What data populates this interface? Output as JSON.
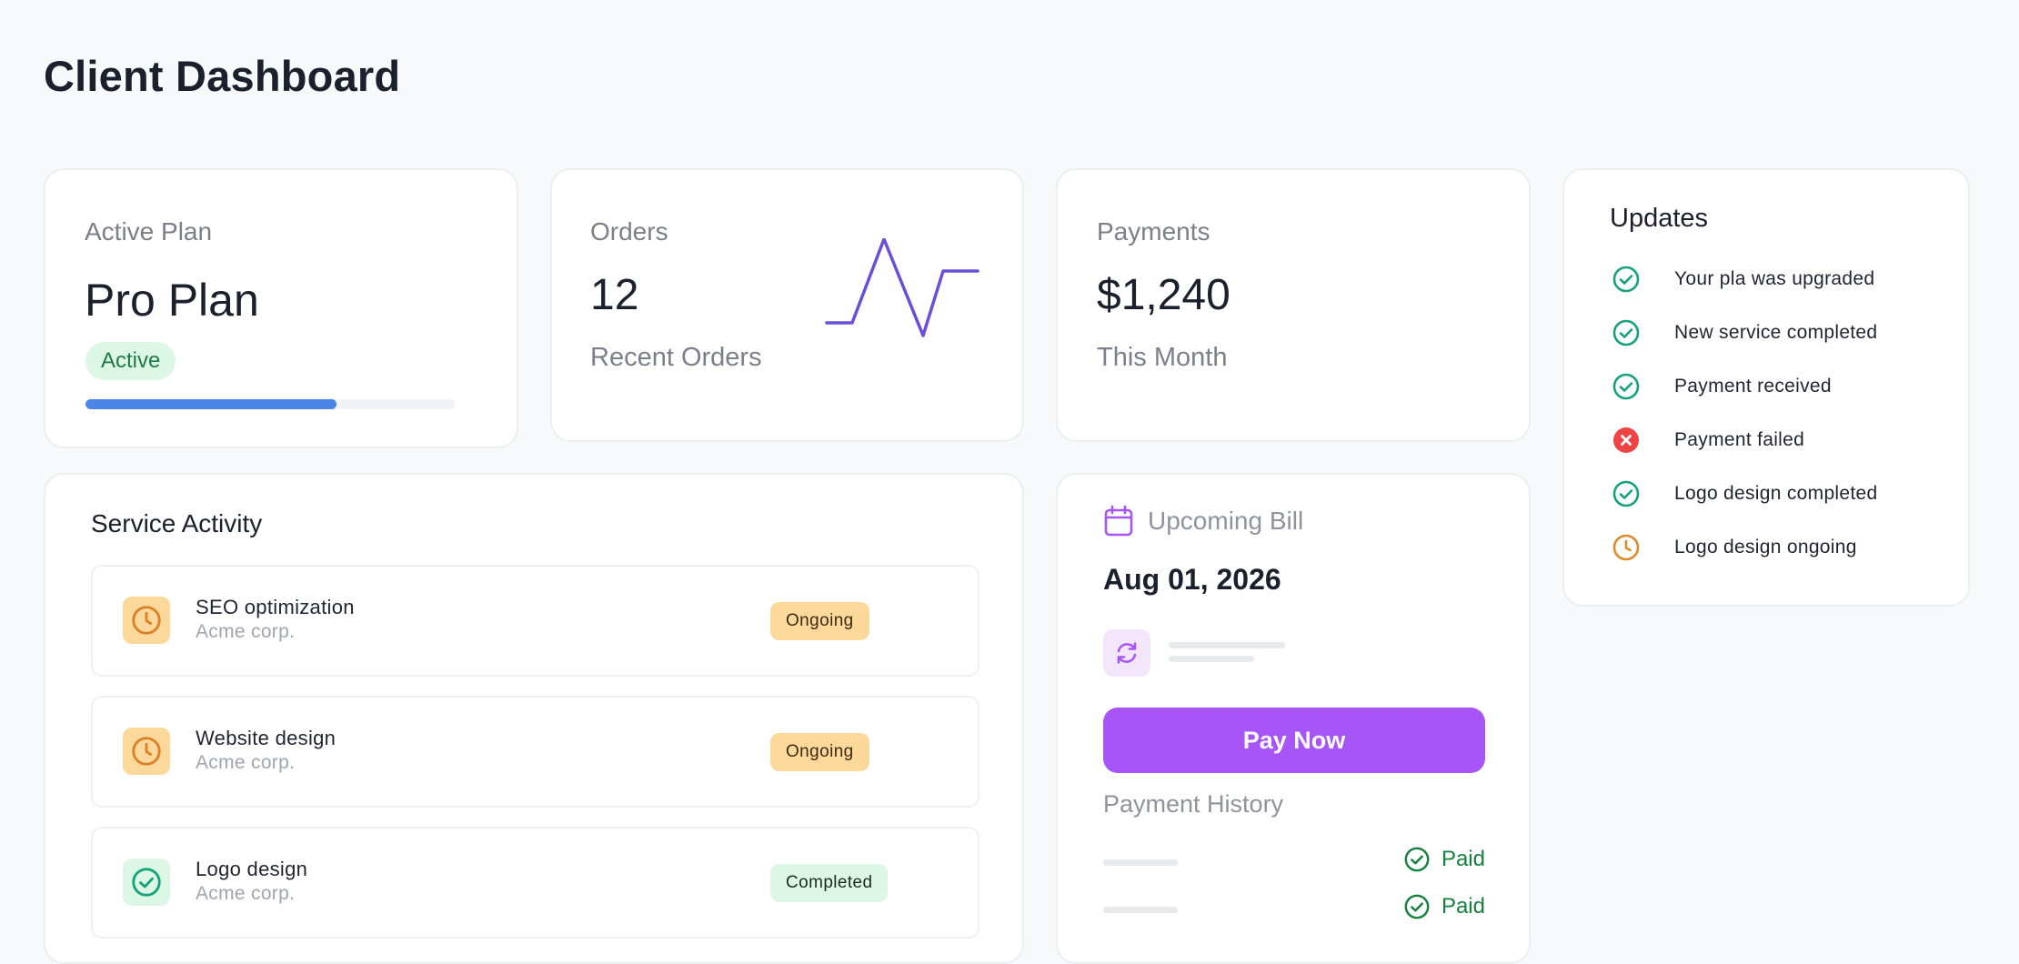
{
  "page": {
    "title": "Client Dashboard"
  },
  "plan": {
    "label": "Active Plan",
    "name": "Pro Plan",
    "status": "Active",
    "progress": 0.68
  },
  "orders": {
    "label": "Orders",
    "count": "12",
    "sub": "Recent Orders"
  },
  "payments": {
    "label": "Payments",
    "amount": "$1,240",
    "sub": "This Month"
  },
  "updates": {
    "title": "Updates",
    "items": [
      {
        "text": "Your pla was upgraded",
        "status": "success"
      },
      {
        "text": "New service completed",
        "status": "success"
      },
      {
        "text": "Payment received",
        "status": "success"
      },
      {
        "text": "Payment failed",
        "status": "error"
      },
      {
        "text": "Logo design completed",
        "status": "success"
      },
      {
        "text": "Logo design ongoing",
        "status": "pending"
      }
    ]
  },
  "service": {
    "title": "Service Activity",
    "rows": [
      {
        "name": "SEO optimization",
        "client": "Acme corp.",
        "status": "Ongoing"
      },
      {
        "name": "Website design",
        "client": "Acme corp.",
        "status": "Ongoing"
      },
      {
        "name": "Logo design",
        "client": "Acme corp.",
        "status": "Completed"
      }
    ]
  },
  "bill": {
    "label": "Upcoming Bill",
    "date": "Aug 01, 2026",
    "pay_label": "Pay Now",
    "history_title": "Payment History",
    "history": [
      {
        "status": "Paid"
      },
      {
        "status": "Paid"
      }
    ]
  },
  "colors": {
    "accent": "#a855f7",
    "progress": "#4a86e8",
    "success": "#16a37a",
    "error": "#ef4444",
    "pending": "#e08a2c",
    "sparkline": "#6a4fd8"
  },
  "icons": {
    "success": "check-circle-icon",
    "error": "x-circle-icon",
    "pending": "clock-icon",
    "calendar": "calendar-icon",
    "sync": "refresh-icon"
  }
}
